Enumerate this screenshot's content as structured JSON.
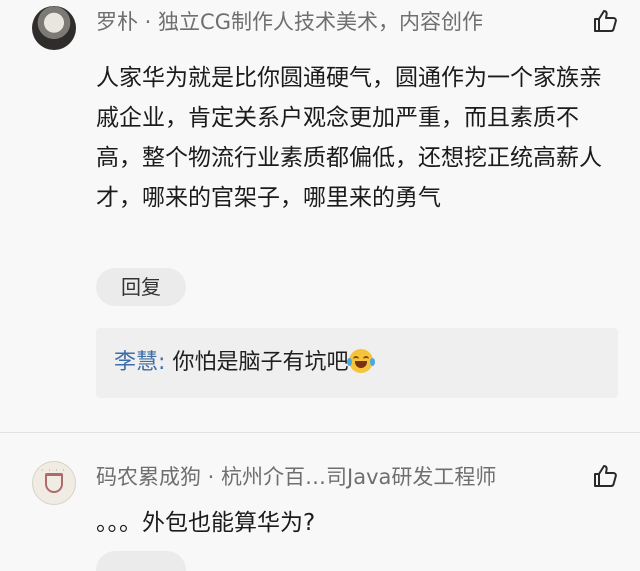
{
  "comments": [
    {
      "author": "罗朴 · 独立CG制作人技术美术，内容创作",
      "text": "人家华为就是比你圆通硬气，圆通作为一个家族亲戚企业，肯定关系户观念更加严重，而且素质不高，整个物流行业素质都偏低，还想挖正统高薪人才，哪来的官架子，哪里来的勇气",
      "reply_label": "回复",
      "sub_replies": [
        {
          "name": "李慧",
          "separator": ":",
          "text": "你怕是脑子有坑吧",
          "emoji": "laughing-crying-emoji"
        }
      ],
      "like_icon": "thumbs-up-icon"
    },
    {
      "author": "码农累成狗 · 杭州介百…司Java研发工程师",
      "text": "。。。外包也能算华为?",
      "like_icon": "thumbs-up-icon"
    }
  ],
  "colors": {
    "background": "#f8f8f8",
    "author": "#6f6f6f",
    "reply_name": "#3f6ea6",
    "reply_bg": "#efefef",
    "button_bg": "#ebebeb"
  }
}
